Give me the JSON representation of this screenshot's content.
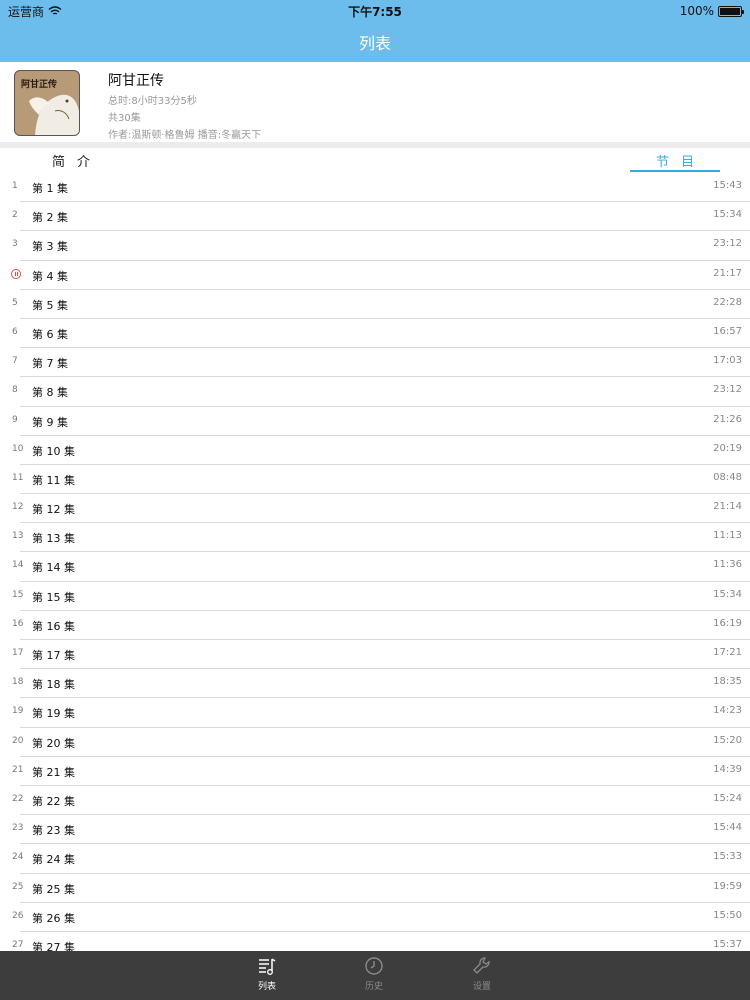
{
  "status": {
    "carrier": "运营商",
    "time": "下午7:55",
    "battery_percent": "100%",
    "battery_level": 1.0
  },
  "nav": {
    "title": "列表"
  },
  "book": {
    "cover_title": "阿甘正传",
    "title": "阿甘正传",
    "total_duration": "总时:8小时33分5秒",
    "episode_count": "共30集",
    "credits": "作者:温斯顿·格鲁姆  播音:冬赢天下"
  },
  "tabs": {
    "intro": "简介",
    "program": "节目"
  },
  "episodes": [
    {
      "index": "1",
      "name": "第 1 集",
      "duration": "15:43"
    },
    {
      "index": "2",
      "name": "第 2 集",
      "duration": "15:34"
    },
    {
      "index": "3",
      "name": "第 3 集",
      "duration": "23:12"
    },
    {
      "index": "4",
      "name": "第 4 集",
      "duration": "21:17",
      "playing": true
    },
    {
      "index": "5",
      "name": "第 5 集",
      "duration": "22:28"
    },
    {
      "index": "6",
      "name": "第 6 集",
      "duration": "16:57"
    },
    {
      "index": "7",
      "name": "第 7 集",
      "duration": "17:03"
    },
    {
      "index": "8",
      "name": "第 8 集",
      "duration": "23:12"
    },
    {
      "index": "9",
      "name": "第 9 集",
      "duration": "21:26"
    },
    {
      "index": "10",
      "name": "第 10 集",
      "duration": "20:19"
    },
    {
      "index": "11",
      "name": "第 11 集",
      "duration": "08:48"
    },
    {
      "index": "12",
      "name": "第 12 集",
      "duration": "21:14"
    },
    {
      "index": "13",
      "name": "第 13 集",
      "duration": "11:13"
    },
    {
      "index": "14",
      "name": "第 14 集",
      "duration": "11:36"
    },
    {
      "index": "15",
      "name": "第 15 集",
      "duration": "15:34"
    },
    {
      "index": "16",
      "name": "第 16 集",
      "duration": "16:19"
    },
    {
      "index": "17",
      "name": "第 17 集",
      "duration": "17:21"
    },
    {
      "index": "18",
      "name": "第 18 集",
      "duration": "18:35"
    },
    {
      "index": "19",
      "name": "第 19 集",
      "duration": "14:23"
    },
    {
      "index": "20",
      "name": "第 20 集",
      "duration": "15:20"
    },
    {
      "index": "21",
      "name": "第 21 集",
      "duration": "14:39"
    },
    {
      "index": "22",
      "name": "第 22 集",
      "duration": "15:24"
    },
    {
      "index": "23",
      "name": "第 23 集",
      "duration": "15:44"
    },
    {
      "index": "24",
      "name": "第 24 集",
      "duration": "15:33"
    },
    {
      "index": "25",
      "name": "第 25 集",
      "duration": "19:59"
    },
    {
      "index": "26",
      "name": "第 26 集",
      "duration": "15:50"
    },
    {
      "index": "27",
      "name": "第 27 集",
      "duration": "15:37"
    }
  ],
  "tabbar": {
    "items": [
      {
        "label": "列表",
        "icon": "music-list-icon",
        "active": true
      },
      {
        "label": "历史",
        "icon": "clock-icon",
        "active": false
      },
      {
        "label": "设置",
        "icon": "wrench-icon",
        "active": false
      }
    ]
  },
  "colors": {
    "header": "#6cbcec",
    "accent": "#3ea7e0",
    "tabbar": "#3d3d3d",
    "playing": "#e04a4a"
  }
}
